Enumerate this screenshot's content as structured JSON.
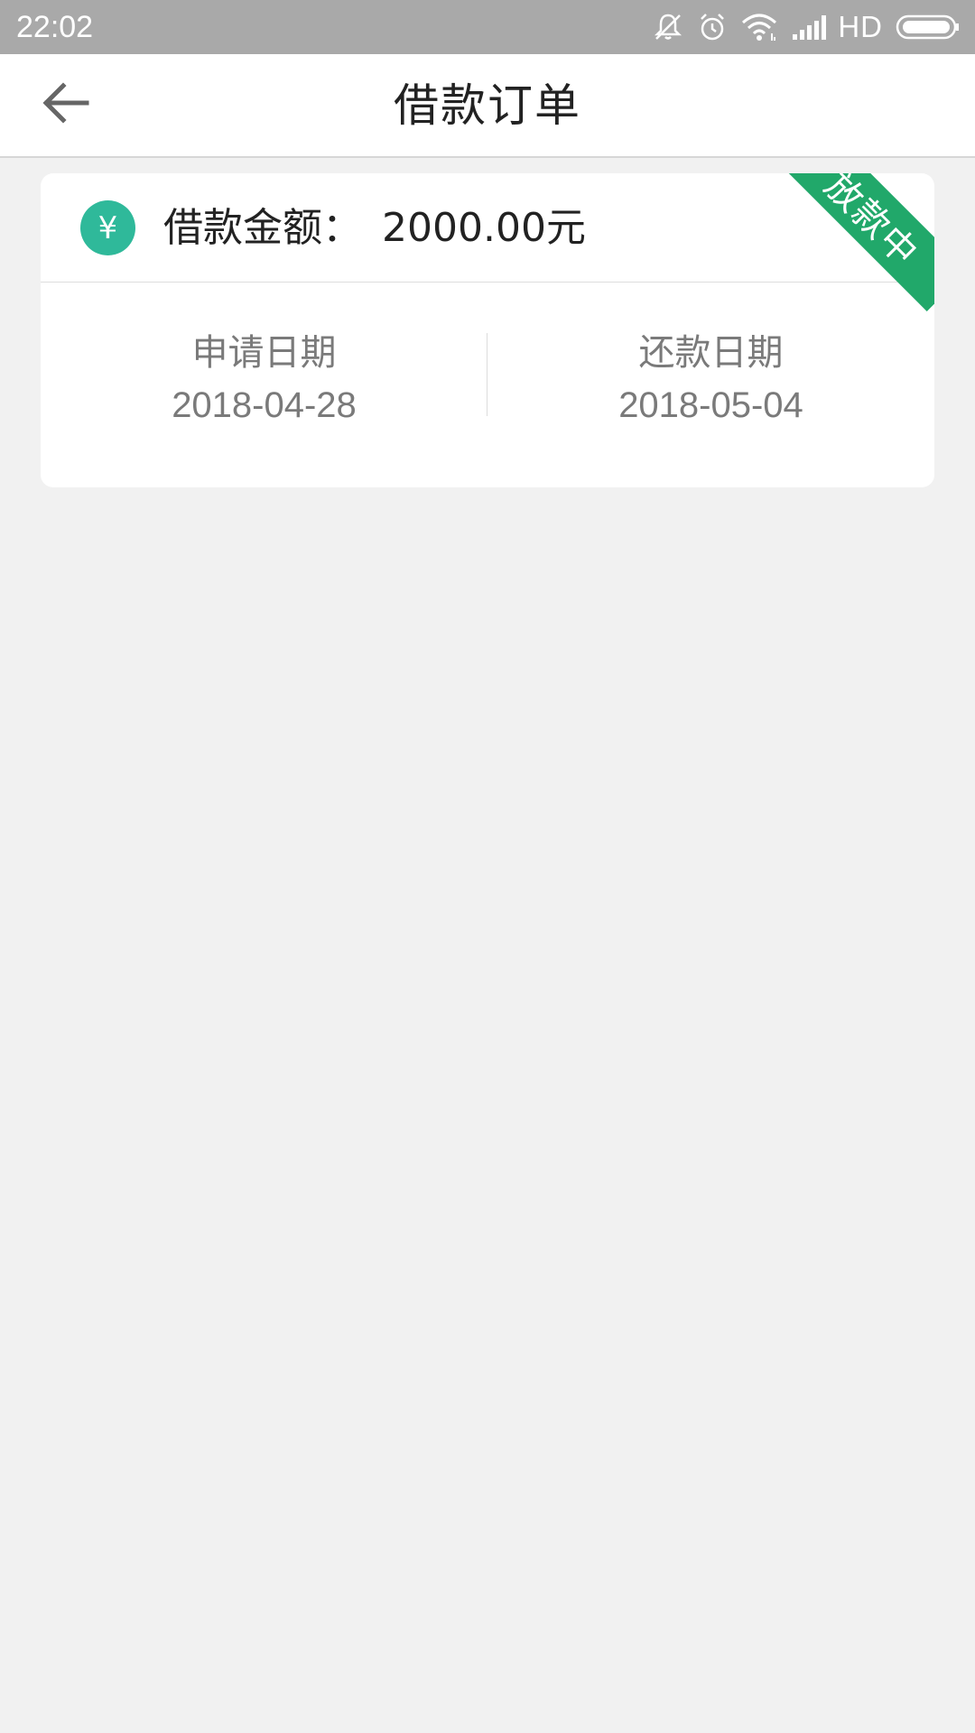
{
  "status_bar": {
    "time": "22:02",
    "network_label": "HD",
    "icons": [
      "mute-icon",
      "alarm-icon",
      "wifi-icon",
      "signal-icon",
      "battery-icon"
    ]
  },
  "app_bar": {
    "title": "借款订单",
    "back_icon": "arrow-left-icon"
  },
  "order": {
    "amount_label": "借款金额：",
    "amount_value": "2000.00元",
    "currency_icon": "¥",
    "status_ribbon": "放款中",
    "apply_date_label": "申请日期",
    "apply_date": "2018-04-28",
    "repay_date_label": "还款日期",
    "repay_date": "2018-05-04"
  },
  "colors": {
    "accent_teal": "#2fb99a",
    "ribbon_green": "#21a86a",
    "status_bar": "#a9a9a9",
    "page_background": "#f1f1f1"
  }
}
